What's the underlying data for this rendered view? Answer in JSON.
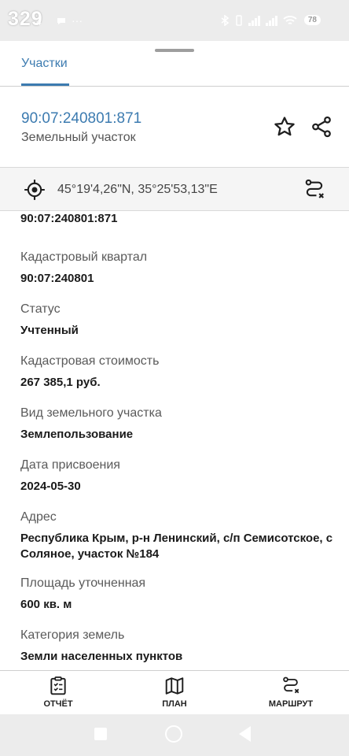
{
  "status_bar": {
    "time": "329",
    "small_text": "4",
    "battery": "78"
  },
  "tabs": [
    {
      "label": "Участки"
    }
  ],
  "parcel": {
    "id": "90:07:240801:871",
    "type": "Земельный участок"
  },
  "coordinates": "45°19'4,26\"N, 35°25'53,13\"E",
  "details": {
    "clipped_value": "90:07:240801:871",
    "fields": [
      {
        "label": "Кадастровый квартал",
        "value": "90:07:240801"
      },
      {
        "label": "Статус",
        "value": "Учтенный"
      },
      {
        "label": "Кадастровая стоимость",
        "value": "267 385,1 руб."
      },
      {
        "label": "Вид земельного участка",
        "value": "Землепользование"
      },
      {
        "label": "Дата присвоения",
        "value": "2024-05-30"
      },
      {
        "label": "Адрес",
        "value": "Республика Крым, р-н Ленинский, с/п Семисотское, с Соляное, участок №184"
      },
      {
        "label": "Площадь уточненная",
        "value": "600 кв. м"
      },
      {
        "label": "Категория земель",
        "value": "Земли населенных пунктов"
      }
    ]
  },
  "bottom_nav": [
    {
      "label": "ОТЧЁТ",
      "icon": "report-icon"
    },
    {
      "label": "ПЛАН",
      "icon": "map-icon"
    },
    {
      "label": "МАРШРУТ",
      "icon": "route-icon"
    }
  ],
  "colors": {
    "accent": "#3c7bb0",
    "text": "#1a1a1a",
    "muted": "#5a5a5a"
  }
}
